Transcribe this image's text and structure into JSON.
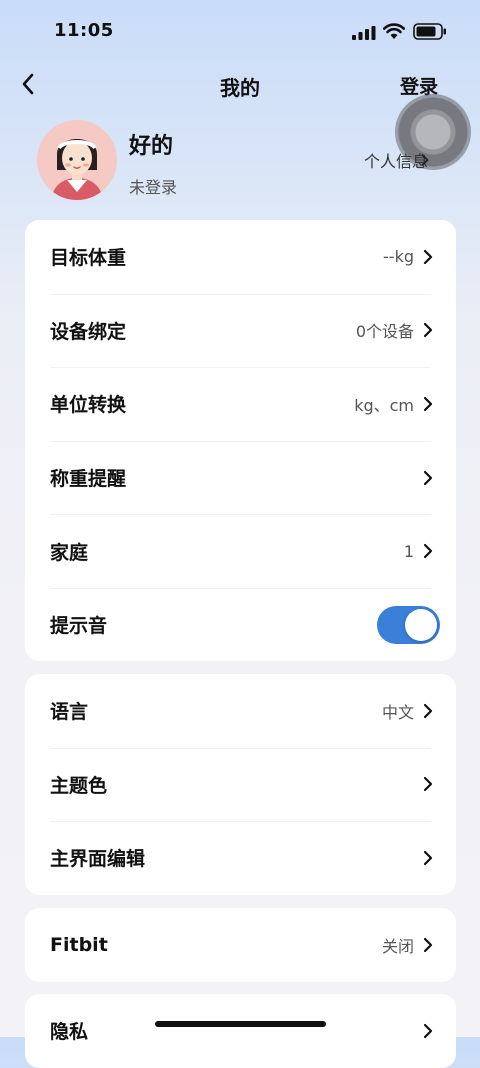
{
  "status_bar": {
    "time": "11:05"
  },
  "nav": {
    "title": "我的",
    "login_label": "登录"
  },
  "profile": {
    "name": "好的",
    "status": "未登录",
    "info_link": "个人信息"
  },
  "settings_group_1": [
    {
      "label": "目标体重",
      "value": "--kg"
    },
    {
      "label": "设备绑定",
      "value": "0个设备"
    },
    {
      "label": "单位转换",
      "value": "kg、cm"
    },
    {
      "label": "称重提醒",
      "value": ""
    },
    {
      "label": "家庭",
      "value": "1"
    },
    {
      "label": "提示音",
      "toggle": true
    }
  ],
  "settings_group_2": [
    {
      "label": "语言",
      "value": "中文"
    },
    {
      "label": "主题色",
      "value": ""
    },
    {
      "label": "主界面编辑",
      "value": ""
    }
  ],
  "settings_group_3": [
    {
      "label": "Fitbit",
      "value": "关闭"
    }
  ],
  "settings_group_4": [
    {
      "label": "隐私",
      "value": ""
    }
  ],
  "colors": {
    "accent": "#3a7fd8",
    "toggle_on": "#3a7fd8"
  }
}
